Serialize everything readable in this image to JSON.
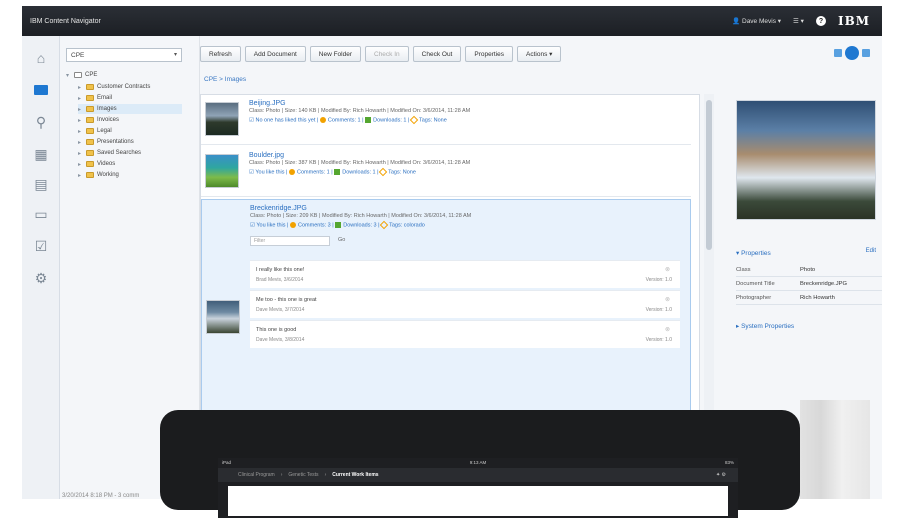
{
  "app": {
    "title": "IBM Content Navigator",
    "user": "Dave Mevis",
    "menu_label": "▾",
    "help": "?",
    "logo": "IBM"
  },
  "repository": {
    "selected": "CPE"
  },
  "tree": {
    "root": "CPE",
    "items": [
      "Customer Contracts",
      "Email",
      "Images",
      "Invoices",
      "Legal",
      "Presentations",
      "Saved Searches",
      "Videos",
      "Working"
    ],
    "selected_index": 2
  },
  "toolbar": {
    "refresh": "Refresh",
    "add_document": "Add Document",
    "new_folder": "New Folder",
    "check_in": "Check In",
    "check_out": "Check Out",
    "properties": "Properties",
    "actions": "Actions ▾"
  },
  "breadcrumb": {
    "path": "CPE  >  Images"
  },
  "items": [
    {
      "title": "Beijing.JPG",
      "meta": "Class: Photo  |  Size: 140 KB  |  Modified By: Rich Howarth  |  Modified On: 3/6/2014, 11:28 AM",
      "likes": "No one has liked this yet",
      "comments": "Comments: 1",
      "downloads": "Downloads: 1",
      "tags": "Tags: None"
    },
    {
      "title": "Boulder.jpg",
      "meta": "Class: Photo  |  Size: 387 KB  |  Modified By: Rich Howarth  |  Modified On: 3/6/2014, 11:28 AM",
      "likes": "You like this",
      "comments": "Comments: 1",
      "downloads": "Downloads: 1",
      "tags": "Tags: None"
    },
    {
      "title": "Breckenridge.JPG",
      "meta": "Class: Photo  |  Size: 209 KB  |  Modified By: Rich Howarth  |  Modified On: 3/6/2014, 11:28 AM",
      "likes": "You like this",
      "comments": "Comments: 3",
      "downloads": "Downloads: 3",
      "tags": "Tags: colorado"
    }
  ],
  "filter": {
    "placeholder": "Filter",
    "go": "Go"
  },
  "comments": [
    {
      "text": "I really like this one!",
      "meta": "Brad Mevis, 3/6/2014",
      "version": "Version: 1.0"
    },
    {
      "text": "Me too - this one is great",
      "meta": "Dave Mevis, 3/7/2014",
      "version": "Version: 1.0"
    },
    {
      "text": "This one is good",
      "meta": "Dave Mevis, 3/8/2014",
      "version": "Version: 1.0"
    }
  ],
  "properties": {
    "header": "Properties",
    "edit": "Edit",
    "rows": [
      {
        "key": "Class",
        "value": "Photo"
      },
      {
        "key": "Document Title",
        "value": "Breckenridge.JPG"
      },
      {
        "key": "Photographer",
        "value": "Rich Howarth"
      }
    ],
    "system_header": "System Properties"
  },
  "status": "3/20/2014 8:18 PM - 3 comm",
  "tablet": {
    "status_left": "iPad",
    "time": "9:13 AM",
    "battery": "83%",
    "nav": [
      "Clinical Program",
      "Genetic Tests",
      "Current Work Items"
    ],
    "current_index": 2
  }
}
